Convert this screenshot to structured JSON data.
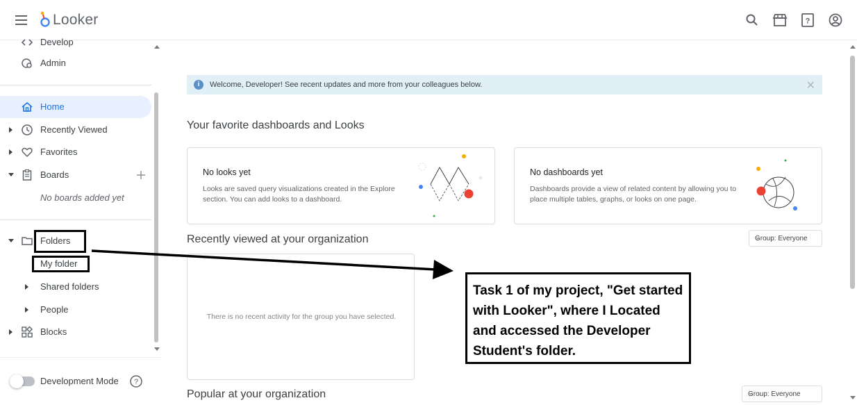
{
  "app": {
    "logo_text": "Looker",
    "brand_colors": {
      "orange": "#f9ab00",
      "blue": "#4285f4",
      "red": "#ea4335",
      "active_nav": "#1a73e8"
    }
  },
  "topbar": {
    "icons": [
      "search-icon",
      "marketplace-icon",
      "help-icon",
      "account-icon"
    ]
  },
  "sidebar": {
    "develop_label": "Develop",
    "admin_label": "Admin",
    "home_label": "Home",
    "recently_viewed_label": "Recently Viewed",
    "favorites_label": "Favorites",
    "boards_label": "Boards",
    "boards_empty": "No boards added yet",
    "folders_label": "Folders",
    "my_folder_label": "My folder",
    "shared_folders_label": "Shared folders",
    "people_label": "People",
    "blocks_label": "Blocks",
    "dev_mode_label": "Development Mode",
    "dev_mode_on": false
  },
  "main": {
    "banner_text": "Welcome, Developer! See recent updates and more from your colleagues below.",
    "favorites_title": "Your favorite dashboards and Looks",
    "looks_card": {
      "title": "No looks yet",
      "desc": "Looks are saved query visualizations created in the Explore section. You can add looks to a dashboard."
    },
    "dashboards_card": {
      "title": "No dashboards yet",
      "desc": "Dashboards provide a view of related content by allowing you to place multiple tables, graphs, or looks on one page."
    },
    "recent_title": "Recently viewed at your organization",
    "recent_group": "Group: Everyone",
    "recent_empty": "There is no recent activity for the group you have selected.",
    "popular_title": "Popular at your organization",
    "popular_group": "Group: Everyone"
  },
  "annotation": {
    "text": "Task 1 of my project, \"Get started with Looker\", where I Located and accessed the Developer Student's folder."
  }
}
